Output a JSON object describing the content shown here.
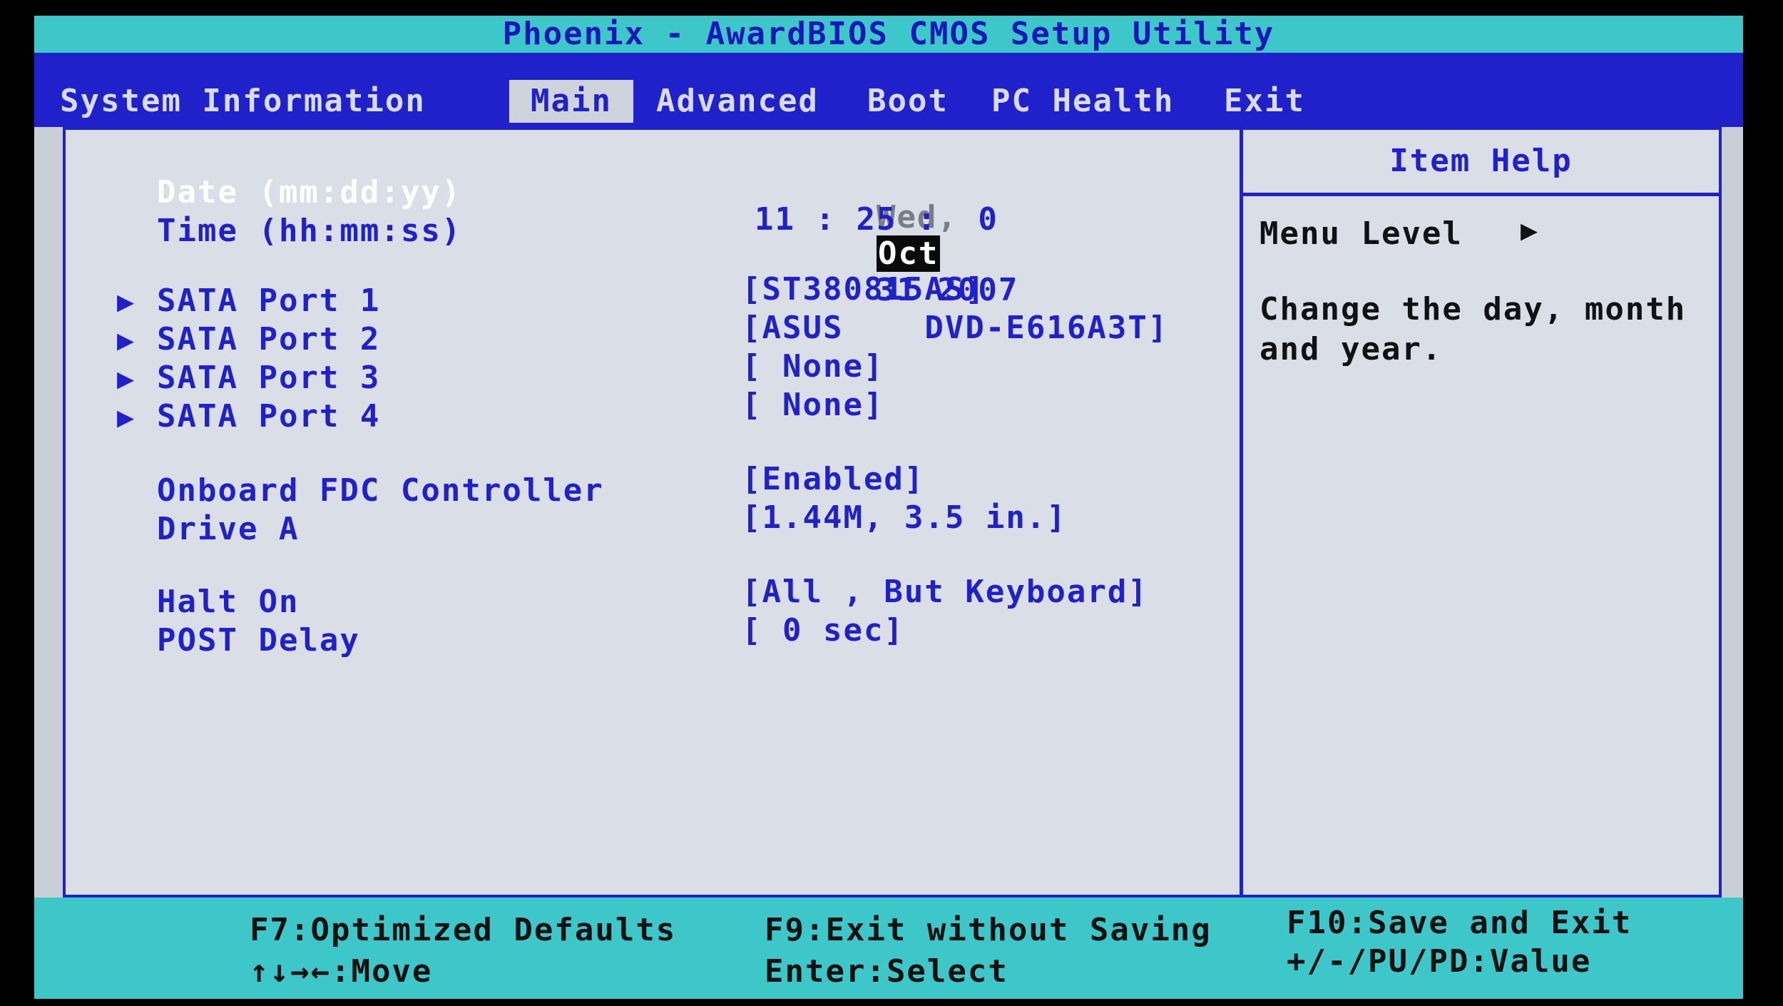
{
  "title": "Phoenix - AwardBIOS CMOS Setup Utility",
  "tabs": [
    "System Information",
    "Main",
    "Advanced",
    "Boot",
    "PC Health",
    "Exit"
  ],
  "active_tab": "Main",
  "items": {
    "date_label": "Date (mm:dd:yy)",
    "time_label": "Time (hh:mm:ss)",
    "sata1_label": "SATA Port 1",
    "sata2_label": "SATA Port 2",
    "sata3_label": "SATA Port 3",
    "sata4_label": "SATA Port 4",
    "fdc_label": "Onboard FDC Controller",
    "drivea_label": "Drive A",
    "halt_label": "Halt On",
    "post_label": "POST Delay"
  },
  "values": {
    "date_day": "Wed,",
    "date_month": "Oct",
    "date_rest": "31 2007",
    "time": "11 : 25 :  0",
    "sata1": "[ST380815AS]",
    "sata2": "[ASUS    DVD-E616A3T]",
    "sata3": "[ None]",
    "sata4": "[ None]",
    "fdc": "[Enabled]",
    "drivea": "[1.44M, 3.5 in.]",
    "halt": "[All , But Keyboard]",
    "post": "[ 0 sec]"
  },
  "help": {
    "title": "Item Help",
    "menu_level": "Menu Level",
    "menu_level_arrow": "▶",
    "text_line1": "Change the day, month",
    "text_line2": "and year."
  },
  "footer": {
    "f7": "F7:Optimized Defaults",
    "move": "↑↓→←:Move",
    "f9": "F9:Exit without Saving",
    "enter": "Enter:Select",
    "f10": "F10:Save and Exit",
    "value": "+/-/PU/PD:Value"
  },
  "icons": {
    "submenu_arrow": "▶"
  },
  "colors": {
    "bios_blue": "#2121cc",
    "bios_cyan": "#3ec7c9",
    "panel_gray": "#dadee6"
  }
}
